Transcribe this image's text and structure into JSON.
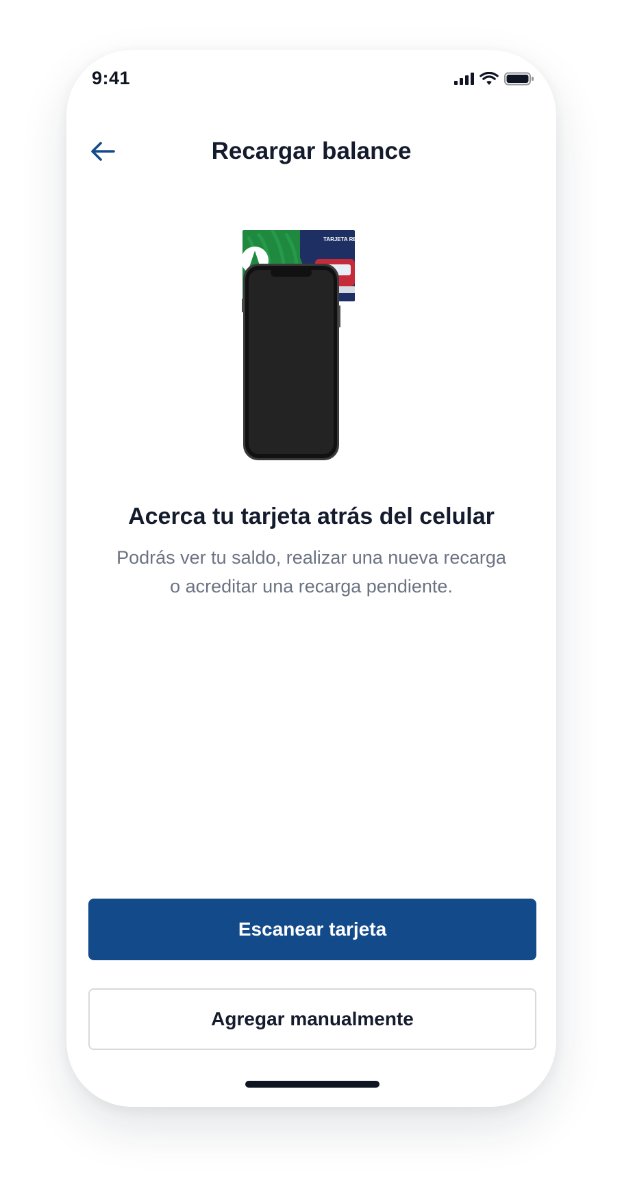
{
  "status_bar": {
    "time": "9:41",
    "icons": [
      "signal-icon",
      "wifi-icon",
      "battery-icon"
    ]
  },
  "header": {
    "title": "Recargar balance",
    "back_icon": "arrow-left-icon"
  },
  "illustration": {
    "card_label": "TARJETA RECARGABLE"
  },
  "instruction": {
    "title": "Acerca tu tarjeta atrás del celular",
    "description_line1": "Podrás ver tu saldo, realizar una nueva recarga",
    "description_line2": "o acreditar una recarga pendiente."
  },
  "actions": {
    "scan_label": "Escanear tarjeta",
    "manual_label": "Agregar manualmente"
  },
  "colors": {
    "primary": "#124a8a",
    "text_dark": "#141b2d",
    "text_muted": "#6b7383",
    "border": "#d6d9de",
    "card_green": "#1f8a3f",
    "card_navy": "#1e2f63"
  }
}
